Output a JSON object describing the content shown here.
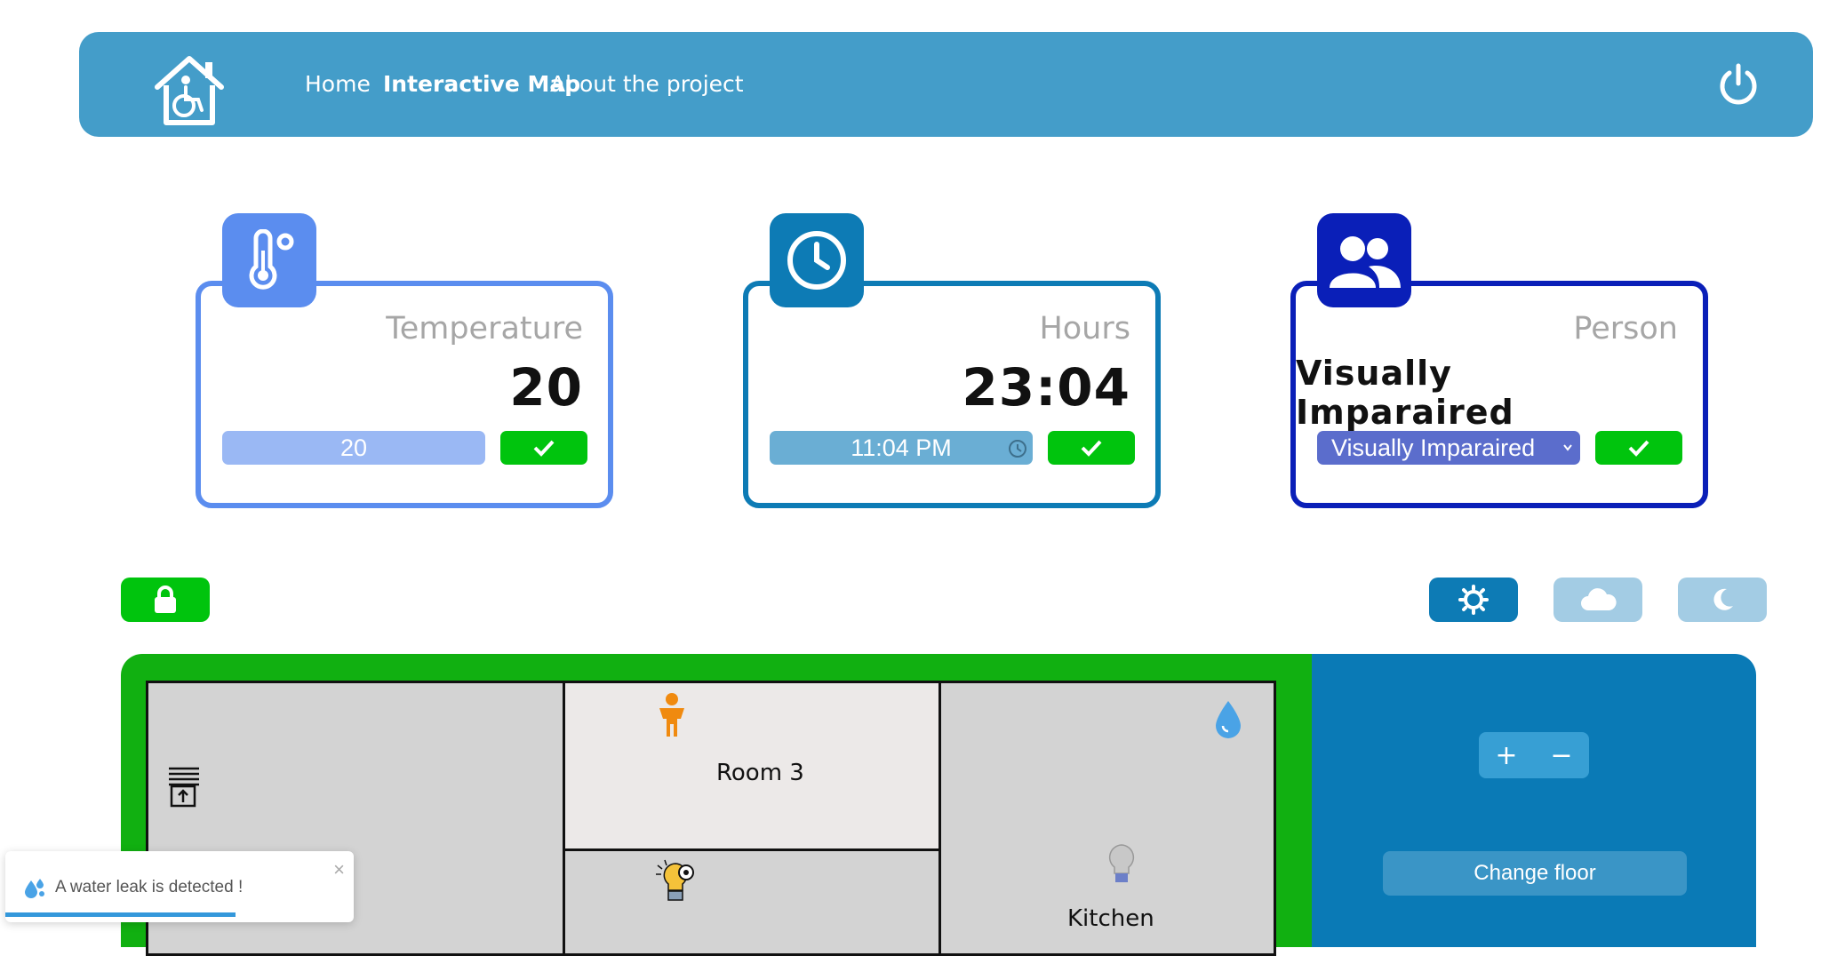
{
  "navbar": {
    "links": [
      "Home",
      "Interactive Map",
      "About the project"
    ],
    "active_index": 1,
    "logo_icon": "accessible-home-icon",
    "power_icon": "power-icon"
  },
  "cards": {
    "temperature": {
      "label": "Temperature",
      "value": "20",
      "input_value": "20",
      "accent": "#5b8def",
      "icon": "thermometer-icon"
    },
    "hours": {
      "label": "Hours",
      "value": "23:04",
      "input_value": "11:04 PM",
      "accent": "#0d7bb5",
      "icon": "clock-icon"
    },
    "person": {
      "label": "Person",
      "value": "Visually Imparaired",
      "select_value": "Visually Imparaired",
      "accent": "#0a1fb8",
      "icon": "users-icon"
    }
  },
  "controls": {
    "lock_icon": "lock-icon",
    "sun_icon": "sun-icon",
    "cloud_icon": "cloud-icon",
    "moon_icon": "moon-icon"
  },
  "map": {
    "rooms": [
      {
        "name": "Room 3"
      },
      {
        "name": "Kitchen"
      }
    ],
    "zoom_in": "+",
    "zoom_out": "−",
    "change_floor": "Change floor"
  },
  "toast": {
    "message": "A water leak is detected !",
    "close": "×",
    "progress": 0.66
  },
  "colors": {
    "navbar": "#449dc9",
    "ok_green": "#00c40d",
    "map_green": "#11b011",
    "map_side": "#0a7ab6"
  }
}
